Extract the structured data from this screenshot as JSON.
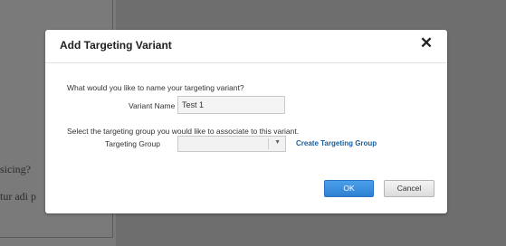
{
  "background": {
    "text_line_1": "sicing?",
    "text_line_2": "tur adi p"
  },
  "dialog": {
    "title": "Add Targeting Variant",
    "close_glyph": "✕",
    "name_prompt": "What would you like to name your targeting variant?",
    "variant_name_label": "Variant Name",
    "variant_name_value": "Test 1",
    "group_prompt": "Select the targeting group you would like to associate to this variant.",
    "targeting_group_label": "Targeting Group",
    "targeting_group_value": "",
    "dropdown_icon": "caret-down",
    "create_group_link": "Create Targeting Group",
    "ok_label": "OK",
    "cancel_label": "Cancel"
  },
  "colors": {
    "overlay": "#6e6e6e",
    "primary_button": "#2f7fd2",
    "link": "#1a5fa0"
  }
}
